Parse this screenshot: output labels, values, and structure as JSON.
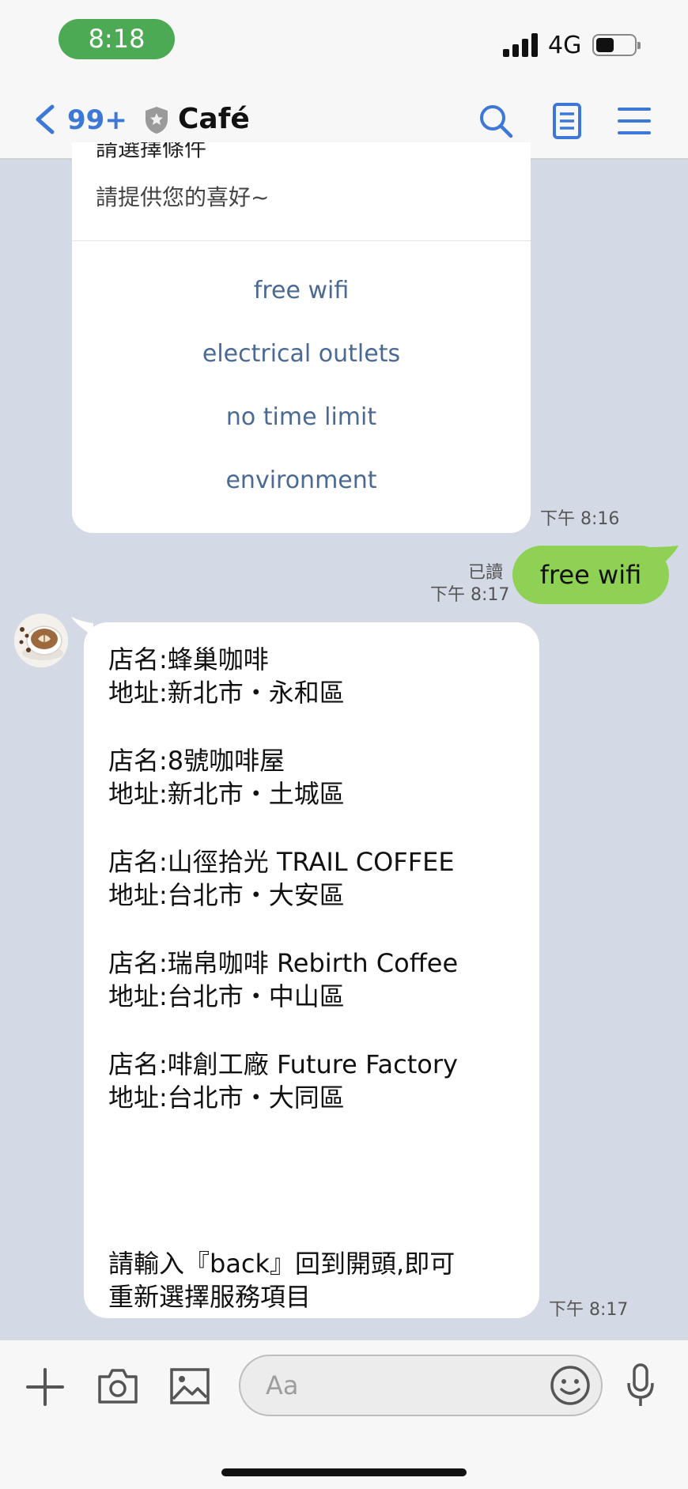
{
  "status_bar": {
    "time": "8:18",
    "network": "4G"
  },
  "header": {
    "unread_count": "99+",
    "title": "Café"
  },
  "card": {
    "title_cut": "請選擇條件",
    "subtitle": "請提供您的喜好~",
    "actions": [
      "free wifi",
      "electrical outlets",
      "no time limit",
      "environment"
    ],
    "timestamp": "下午 8:16"
  },
  "outgoing": {
    "read_label": "已讀",
    "timestamp": "下午 8:17",
    "text": "free wifi"
  },
  "incoming": {
    "lines": [
      "店名:蜂巢咖啡",
      "地址:新北市・永和區",
      "店名:8號咖啡屋",
      "地址:新北市・土城區",
      "店名:山徑拾光 TRAIL COFFEE",
      "地址:台北市・大安區",
      "店名:瑞帛咖啡 Rebirth Coffee",
      "地址:台北市・中山區",
      "店名:啡創工廠 Future Factory",
      "地址:台北市・大同區",
      "請輸入『back』回到開頭,即可",
      "重新選擇服務項目"
    ],
    "timestamp": "下午 8:17"
  },
  "input": {
    "placeholder": "Aa"
  },
  "colors": {
    "accent": "#3d78d8",
    "outgoing_bubble": "#8ed155",
    "time_pill": "#4caa55",
    "chat_background": "#d3dae5",
    "action_text": "#4a6a94"
  },
  "icons": [
    "back-chevron-icon",
    "shield-icon",
    "search-icon",
    "notes-icon",
    "menu-icon",
    "plus-icon",
    "camera-icon",
    "image-icon",
    "emoji-icon",
    "microphone-icon"
  ]
}
